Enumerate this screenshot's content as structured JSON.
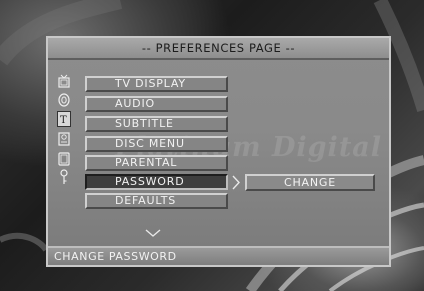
{
  "page_title": "-- PREFERENCES PAGE --",
  "watermark": "Platinum Digital",
  "menu": {
    "selected_index": 5,
    "items": [
      {
        "label": "TV DISPLAY",
        "icon": "tv-icon"
      },
      {
        "label": "AUDIO",
        "icon": "speaker-icon"
      },
      {
        "label": "SUBTITLE",
        "icon": "subtitle-icon"
      },
      {
        "label": "DISC MENU",
        "icon": "disc-menu-icon"
      },
      {
        "label": "PARENTAL",
        "icon": "parental-icon"
      },
      {
        "label": "PASSWORD",
        "icon": "key-icon"
      },
      {
        "label": "DEFAULTS",
        "icon": ""
      }
    ]
  },
  "submenu": {
    "change_label": "CHANGE"
  },
  "status_text": "CHANGE PASSWORD",
  "colors": {
    "panel": "#8a8a8a",
    "selected_item": "#3e3e3e",
    "text": "#f2f2f2"
  }
}
